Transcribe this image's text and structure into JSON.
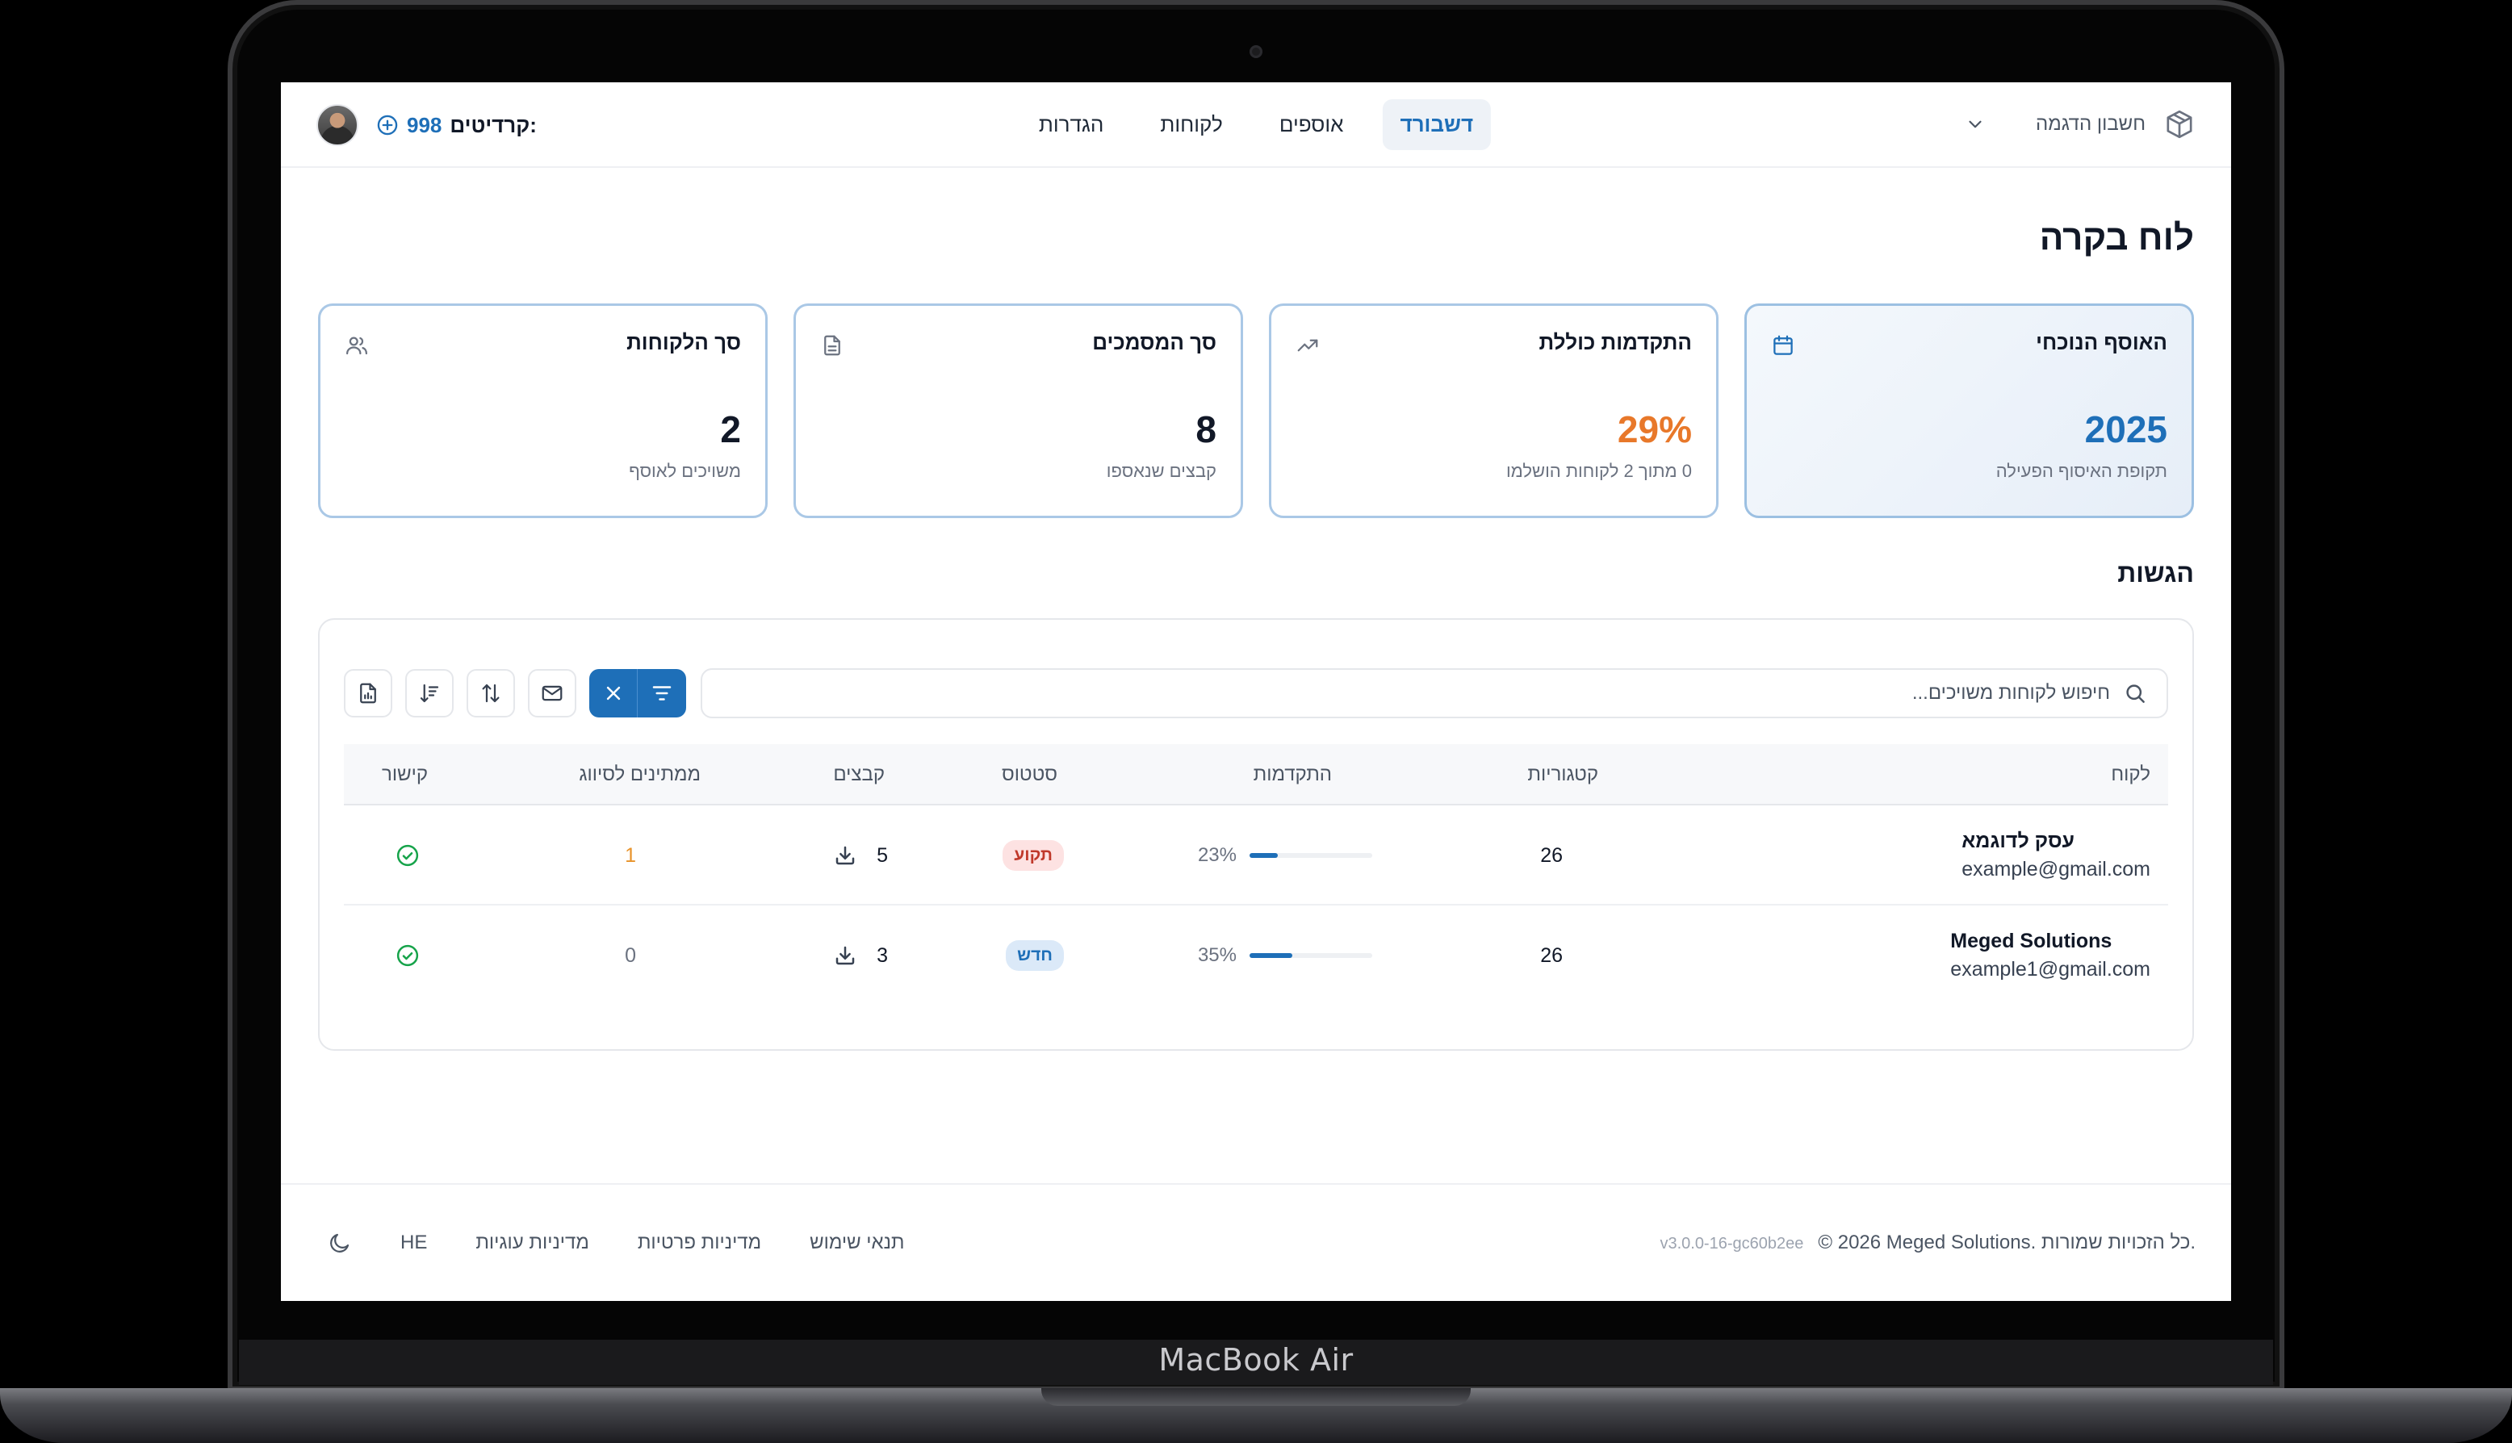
{
  "header": {
    "account_name": "חשבון הדגמה",
    "nav": [
      {
        "label": "דשבורד",
        "active": true
      },
      {
        "label": "אוספים",
        "active": false
      },
      {
        "label": "לקוחות",
        "active": false
      },
      {
        "label": "הגדרות",
        "active": false
      }
    ],
    "credits_label": "קרדיטים:",
    "credits_value": "998"
  },
  "page_title": "לוח בקרה",
  "cards": [
    {
      "title": "האוסף הנוכחי",
      "value": "2025",
      "sub": "תקופת האיסוף הפעילה",
      "icon": "calendar-icon"
    },
    {
      "title": "התקדמות כוללת",
      "value": "29%",
      "sub": "0 מתוך 2 לקוחות הושלמו",
      "icon": "trending-up-icon"
    },
    {
      "title": "סך המסמכים",
      "value": "8",
      "sub": "קבצים שנאספו",
      "icon": "file-icon"
    },
    {
      "title": "סך הלקוחות",
      "value": "2",
      "sub": "משויכים לאוסף",
      "icon": "users-icon"
    }
  ],
  "submissions": {
    "title": "הגשות",
    "search_placeholder": "חיפוש לקוחות משויכים...",
    "columns": {
      "customer": "לקוח",
      "categories": "קטגוריות",
      "progress": "התקדמות",
      "status": "סטטוס",
      "files": "קבצים",
      "pending": "ממתינים לסיווג",
      "link": "קישור"
    },
    "rows": [
      {
        "name": "עסק לדוגמא",
        "email": "example@gmail.com",
        "categories": "26",
        "progress": 23,
        "progress_label": "23%",
        "status": "תקוע",
        "files": "5",
        "pending": "1"
      },
      {
        "name": "Meged Solutions",
        "email": "example1@gmail.com",
        "categories": "26",
        "progress": 35,
        "progress_label": "35%",
        "status": "חדש",
        "files": "3",
        "pending": "0"
      }
    ]
  },
  "footer": {
    "copyright": "© 2026 Meged Solutions. כל הזכויות שמורות.",
    "version": "v3.0.0-16-gc60b2ee",
    "links": [
      "תנאי שימוש",
      "מדיניות פרטיות",
      "מדיניות עוגיות"
    ],
    "lang": "HE"
  },
  "device_label": "MacBook Air",
  "colors": {
    "accent": "#1e6fb8",
    "orange": "#e8782a",
    "success": "#16a34a",
    "danger": "#c0392b"
  }
}
